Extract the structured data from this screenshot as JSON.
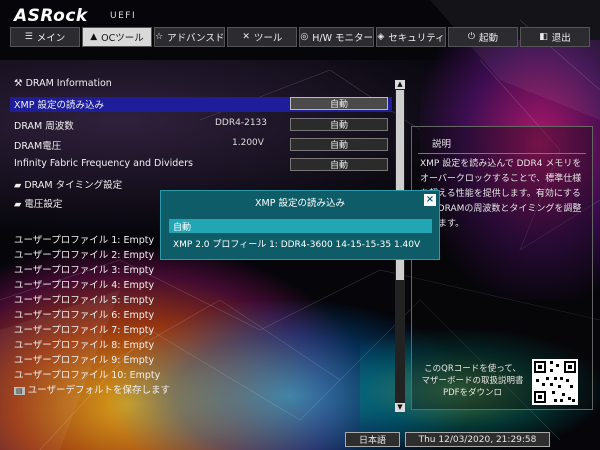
{
  "brand": {
    "logo": "ASRock",
    "sub": "UEFI"
  },
  "tabs": [
    {
      "label": "メイン",
      "icon": "list-icon"
    },
    {
      "label": "OCツール",
      "icon": "rocket-icon"
    },
    {
      "label": "アドバンスド",
      "icon": "star-icon"
    },
    {
      "label": "ツール",
      "icon": "tools-icon"
    },
    {
      "label": "H/W モニター",
      "icon": "monitor-icon"
    },
    {
      "label": "セキュリティ",
      "icon": "shield-icon"
    },
    {
      "label": "起動",
      "icon": "power-icon"
    },
    {
      "label": "退出",
      "icon": "exit-icon"
    }
  ],
  "main": {
    "section_title": "DRAM Information",
    "rows": [
      {
        "label": "XMP 設定の読み込み",
        "button": "自動"
      },
      {
        "label": "DRAM 周波数",
        "value": "DDR4-2133",
        "button": "自動"
      },
      {
        "label": "DRAM電圧",
        "value": "1.200V",
        "button": "自動"
      },
      {
        "label": "Infinity Fabric Frequency and Dividers",
        "button": "自動"
      }
    ],
    "submenus": [
      "DRAM タイミング設定",
      "電圧設定"
    ],
    "profiles": [
      "ユーザープロファイル 1: Empty",
      "ユーザープロファイル 2: Empty",
      "ユーザープロファイル 3: Empty",
      "ユーザープロファイル 4: Empty",
      "ユーザープロファイル 5: Empty",
      "ユーザープロファイル 6: Empty",
      "ユーザープロファイル 7: Empty",
      "ユーザープロファイル 8: Empty",
      "ユーザープロファイル 9: Empty",
      "ユーザープロファイル 10: Empty"
    ],
    "save_default": "ユーザーデフォルトを保存します"
  },
  "description": {
    "title": "説明",
    "text": "XMP 設定を読み込んで DDR4 メモリをオーバークロックすることで、標準仕様を超える性能を提供します。有効にすると、DRAMの周波数とタイミングを調整できます。",
    "qr_text": "このQRコードを使って、マザーボードの取扱説明書PDFをダウンロ"
  },
  "popup": {
    "title": "XMP 設定の読み込み",
    "options": [
      "自動",
      "XMP 2.0 プロフィール 1: DDR4-3600 14-15-15-35 1.40V"
    ]
  },
  "footer": {
    "language": "日本語",
    "datetime": "Thu 12/03/2020, 21:29:58"
  }
}
